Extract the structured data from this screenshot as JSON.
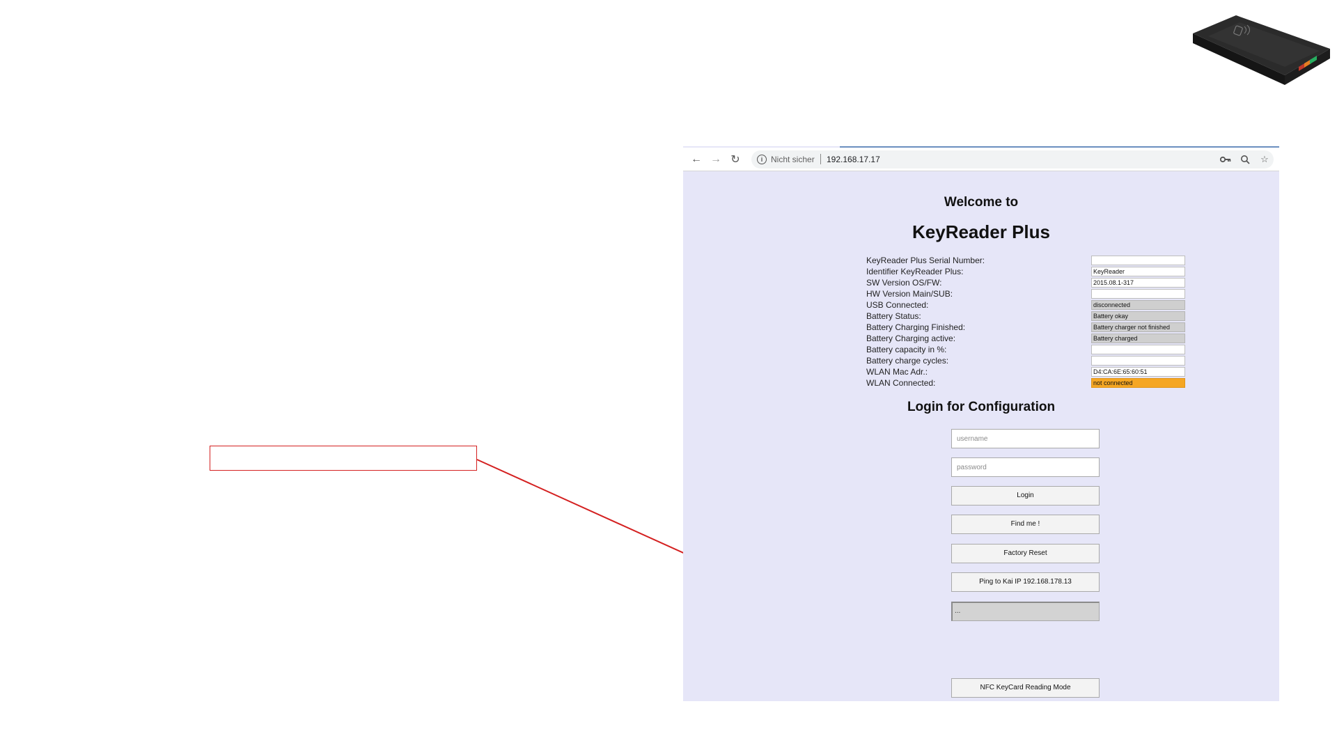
{
  "browser": {
    "security_label": "Nicht sicher",
    "url": "192.168.17.17"
  },
  "page": {
    "welcome": "Welcome to",
    "product_name": "KeyReader Plus",
    "status": [
      {
        "label": "KeyReader Plus Serial Number:",
        "value": "",
        "style": "white"
      },
      {
        "label": "Identifier KeyReader Plus:",
        "value": "KeyReader",
        "style": "white"
      },
      {
        "label": "SW Version OS/FW:",
        "value": "2015.08.1-317",
        "style": "white"
      },
      {
        "label": "HW Version Main/SUB:",
        "value": "",
        "style": "white"
      },
      {
        "label": "USB Connected:",
        "value": "disconnected",
        "style": "gray"
      },
      {
        "label": "Battery Status:",
        "value": "Battery okay",
        "style": "gray"
      },
      {
        "label": "Battery Charging Finished:",
        "value": "Battery charger not finished",
        "style": "gray"
      },
      {
        "label": "Battery Charging active:",
        "value": "Battery charged",
        "style": "gray"
      },
      {
        "label": "Battery capacity in %:",
        "value": "",
        "style": "white"
      },
      {
        "label": "Battery charge cycles:",
        "value": "",
        "style": "white"
      },
      {
        "label": "WLAN Mac Adr.:",
        "value": "D4:CA:6E:65:60:51",
        "style": "white"
      },
      {
        "label": "WLAN Connected:",
        "value": "not connected",
        "style": "orange"
      }
    ],
    "login_title": "Login for Configuration",
    "username_placeholder": "username",
    "password_placeholder": "password",
    "login_label": "Login",
    "findme_label": "Find me !",
    "reset_label": "Factory Reset",
    "ping_label": "Ping to Kai IP 192.168.178.13",
    "output_text": "...",
    "nfc_label": "NFC KeyCard Reading Mode"
  },
  "colors": {
    "annotation": "#d42020",
    "page_background": "#e6e6f8",
    "wlan_status": "#f5a623"
  }
}
